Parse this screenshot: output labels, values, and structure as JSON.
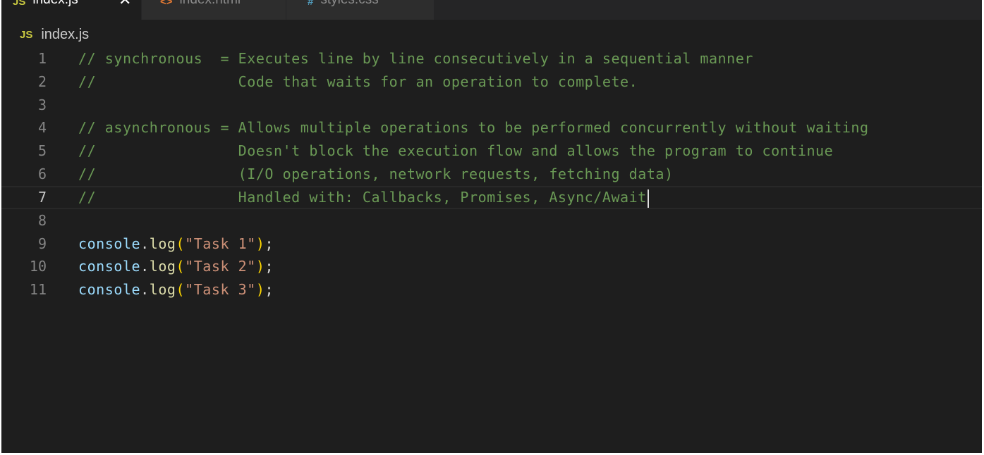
{
  "tabs": [
    {
      "icon": "JS",
      "label": "index.js",
      "close": "✕",
      "active": true
    },
    {
      "icon": "<>",
      "label": "index.html",
      "active": false
    },
    {
      "icon": "#",
      "label": "styles.css",
      "active": false
    }
  ],
  "breadcrumb": {
    "icon": "JS",
    "file": "index.js"
  },
  "editor": {
    "current_line": 7,
    "lines": [
      {
        "num": "1",
        "text": "// synchronous  = Executes line by line consecutively in a sequential manner"
      },
      {
        "num": "2",
        "text": "//                Code that waits for an operation to complete."
      },
      {
        "num": "3",
        "text": ""
      },
      {
        "num": "4",
        "text": "// asynchronous = Allows multiple operations to be performed concurrently without waiting"
      },
      {
        "num": "5",
        "text": "//                Doesn't block the execution flow and allows the program to continue"
      },
      {
        "num": "6",
        "text": "//                (I/O operations, network requests, fetching data)"
      },
      {
        "num": "7",
        "text": "//                Handled with: Callbacks, Promises, Async/Await"
      },
      {
        "num": "8",
        "text": ""
      },
      {
        "num": "9",
        "obj": "console",
        "dot": ".",
        "method": "log",
        "open": "(",
        "arg": "\"Task 1\"",
        "close": ")",
        "end": ";"
      },
      {
        "num": "10",
        "obj": "console",
        "dot": ".",
        "method": "log",
        "open": "(",
        "arg": "\"Task 2\"",
        "close": ")",
        "end": ";"
      },
      {
        "num": "11",
        "obj": "console",
        "dot": ".",
        "method": "log",
        "open": "(",
        "arg": "\"Task 3\"",
        "close": ")",
        "end": ";"
      }
    ]
  },
  "colors": {
    "background": "#1e1e1e",
    "comment": "#6a9955",
    "variable": "#9cdcfe",
    "function": "#dcdcaa",
    "string": "#ce9178",
    "bracket": "#ffd700",
    "line_number": "#858585"
  }
}
